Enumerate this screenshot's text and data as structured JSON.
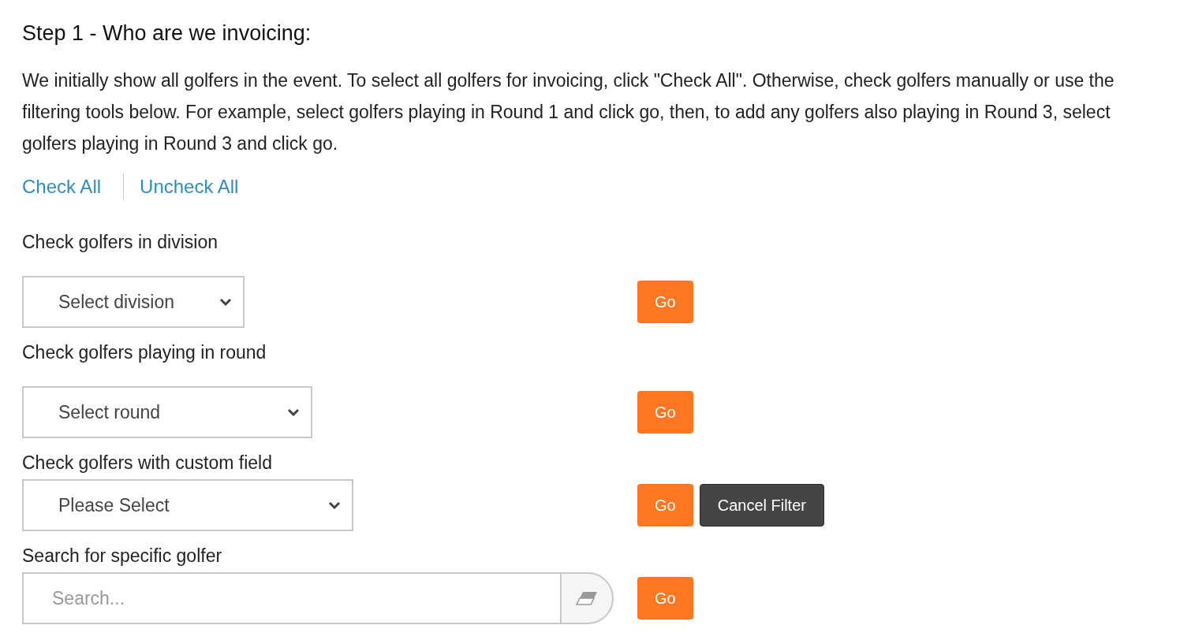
{
  "heading": "Step 1 - Who are we invoicing:",
  "intro": "We initially show all golfers in the event. To select all golfers for invoicing, click \"Check All\". Otherwise, check golfers manually or use the filtering tools below. For example, select golfers playing in Round 1 and click go, then, to add any golfers also playing in Round 3, select golfers playing in Round 3 and click go.",
  "links": [
    "Check All",
    "Uncheck All"
  ],
  "filters": [
    {
      "kind": "select",
      "label": "Check golfers in division",
      "value": "Select division",
      "buttons": [
        {
          "kind": "primary",
          "label": "Go"
        }
      ]
    },
    {
      "kind": "select",
      "label": "Check golfers playing in round",
      "value": "Select round",
      "buttons": [
        {
          "kind": "primary",
          "label": "Go"
        }
      ]
    },
    {
      "kind": "select",
      "label": "Check golfers with custom field",
      "value": "Please Select",
      "buttons": [
        {
          "kind": "primary",
          "label": "Go"
        },
        {
          "kind": "dark",
          "label": "Cancel Filter"
        }
      ]
    },
    {
      "kind": "search",
      "label": "Search for specific golfer",
      "placeholder": "Search...",
      "buttons": [
        {
          "kind": "primary",
          "label": "Go"
        }
      ]
    }
  ]
}
